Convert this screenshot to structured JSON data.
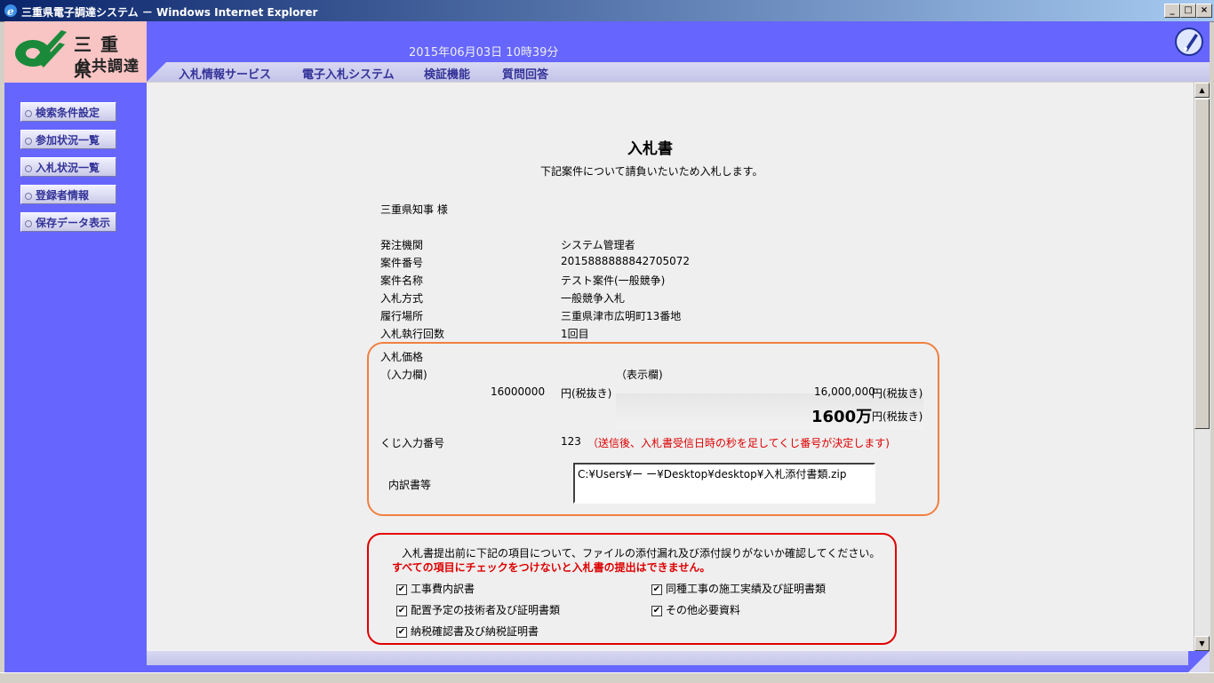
{
  "window": {
    "title": "三重県電子調達システム － Windows Internet Explorer",
    "minimize": "_",
    "maximize": "□",
    "close": "×"
  },
  "header": {
    "logo_line1": "三重県",
    "logo_line2": "公共調達",
    "datetime": "2015年06月03日 10時39分",
    "help_icon": "help-pen-icon",
    "brand_color": "#6666ff"
  },
  "nav": {
    "items": [
      "入札情報サービス",
      "電子入札システム",
      "検証機能",
      "質問回答"
    ]
  },
  "sidebar": {
    "items": [
      "検索条件設定",
      "参加状況一覧",
      "入札状況一覧",
      "登録者情報",
      "保存データ表示"
    ]
  },
  "document": {
    "title": "入札書",
    "subtitle": "下記案件について請負いたいため入札します。",
    "addressee": "三重県知事  様",
    "fields": [
      {
        "label": "発注機関",
        "value": "システム管理者"
      },
      {
        "label": "案件番号",
        "value": "2015888888842705072"
      },
      {
        "label": "案件名称",
        "value": "テスト案件(一般競争)"
      },
      {
        "label": "入札方式",
        "value": "一般競争入札"
      },
      {
        "label": "履行場所",
        "value": "三重県津市広明町13番地"
      },
      {
        "label": "入札執行回数",
        "value": "1回目"
      }
    ]
  },
  "bid": {
    "price_label": "入札価格",
    "input_col_label": "（入力欄)",
    "display_col_label": "（表示欄)",
    "input_value": "16000000",
    "input_unit": "円(税抜き)",
    "display_value": "16,000,000",
    "display_unit": "円(税抜き)",
    "display_value_large": "1600万",
    "display_unit_large": "円(税抜き)",
    "lottery_label": "くじ入力番号",
    "lottery_value": "123",
    "lottery_note": "（送信後、入札書受信日時の秒を足してくじ番号が決定します)",
    "attachment_label": "内訳書等",
    "attachment_path": "C:¥Users¥ー ー¥Desktop¥desktop¥入札添付書類.zip"
  },
  "confirm": {
    "message": "入札書提出前に下記の項目について、ファイルの添付漏れ及び添付誤りがないか確認してください。",
    "warning": "すべての項目にチェックをつけないと入札書の提出はできません。",
    "checks": [
      {
        "label": "工事費内訳書",
        "checked": true
      },
      {
        "label": "同種工事の施工実績及び証明書類",
        "checked": true
      },
      {
        "label": "配置予定の技術者及び証明書類",
        "checked": true
      },
      {
        "label": "その他必要資料",
        "checked": true
      },
      {
        "label": "納税確認書及び納税証明書",
        "checked": true
      }
    ],
    "check_mark": "✔"
  }
}
